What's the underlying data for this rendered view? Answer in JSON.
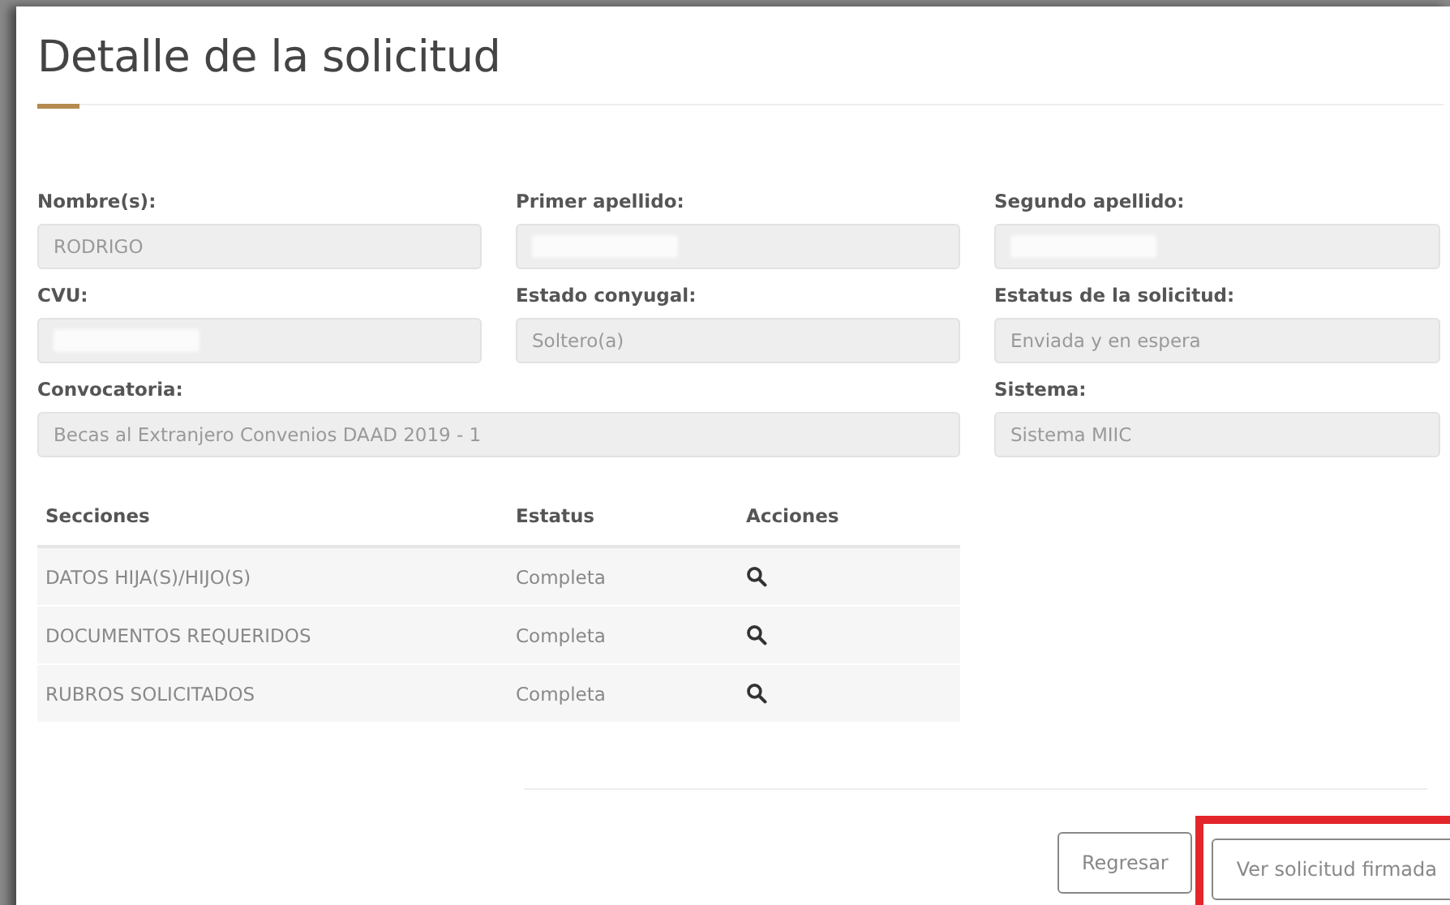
{
  "title": "Detalle de la solicitud",
  "fields": [
    {
      "label": "Nombre(s):",
      "value": "RODRIGO",
      "redacted": false,
      "wide": false
    },
    {
      "label": "Primer apellido:",
      "redacted": true,
      "wide": false
    },
    {
      "label": "Segundo apellido:",
      "redacted": true,
      "wide": false
    },
    {
      "label": "CVU:",
      "redacted": true,
      "wide": false
    },
    {
      "label": "Estado conyugal:",
      "value": "Soltero(a)",
      "redacted": false,
      "wide": false
    },
    {
      "label": "Estatus de la solicitud:",
      "value": "Enviada y en espera",
      "redacted": false,
      "wide": false
    },
    {
      "label": "Convocatoria:",
      "value": "Becas al Extranjero Convenios DAAD 2019 - 1",
      "redacted": false,
      "wide": true
    },
    {
      "label": "Sistema:",
      "value": "Sistema MIIC",
      "redacted": false,
      "wide": false
    }
  ],
  "table": {
    "columns": [
      "Secciones",
      "Estatus",
      "Acciones"
    ],
    "rows": [
      {
        "section": "DATOS HIJA(S)/HIJO(S)",
        "status": "Completa"
      },
      {
        "section": "DOCUMENTOS REQUERIDOS",
        "status": "Completa"
      },
      {
        "section": "RUBROS SOLICITADOS",
        "status": "Completa"
      }
    ]
  },
  "buttons": [
    {
      "label": "Regresar",
      "highlighted": false
    },
    {
      "label": "Ver solicitud firmada",
      "highlighted": true
    }
  ]
}
